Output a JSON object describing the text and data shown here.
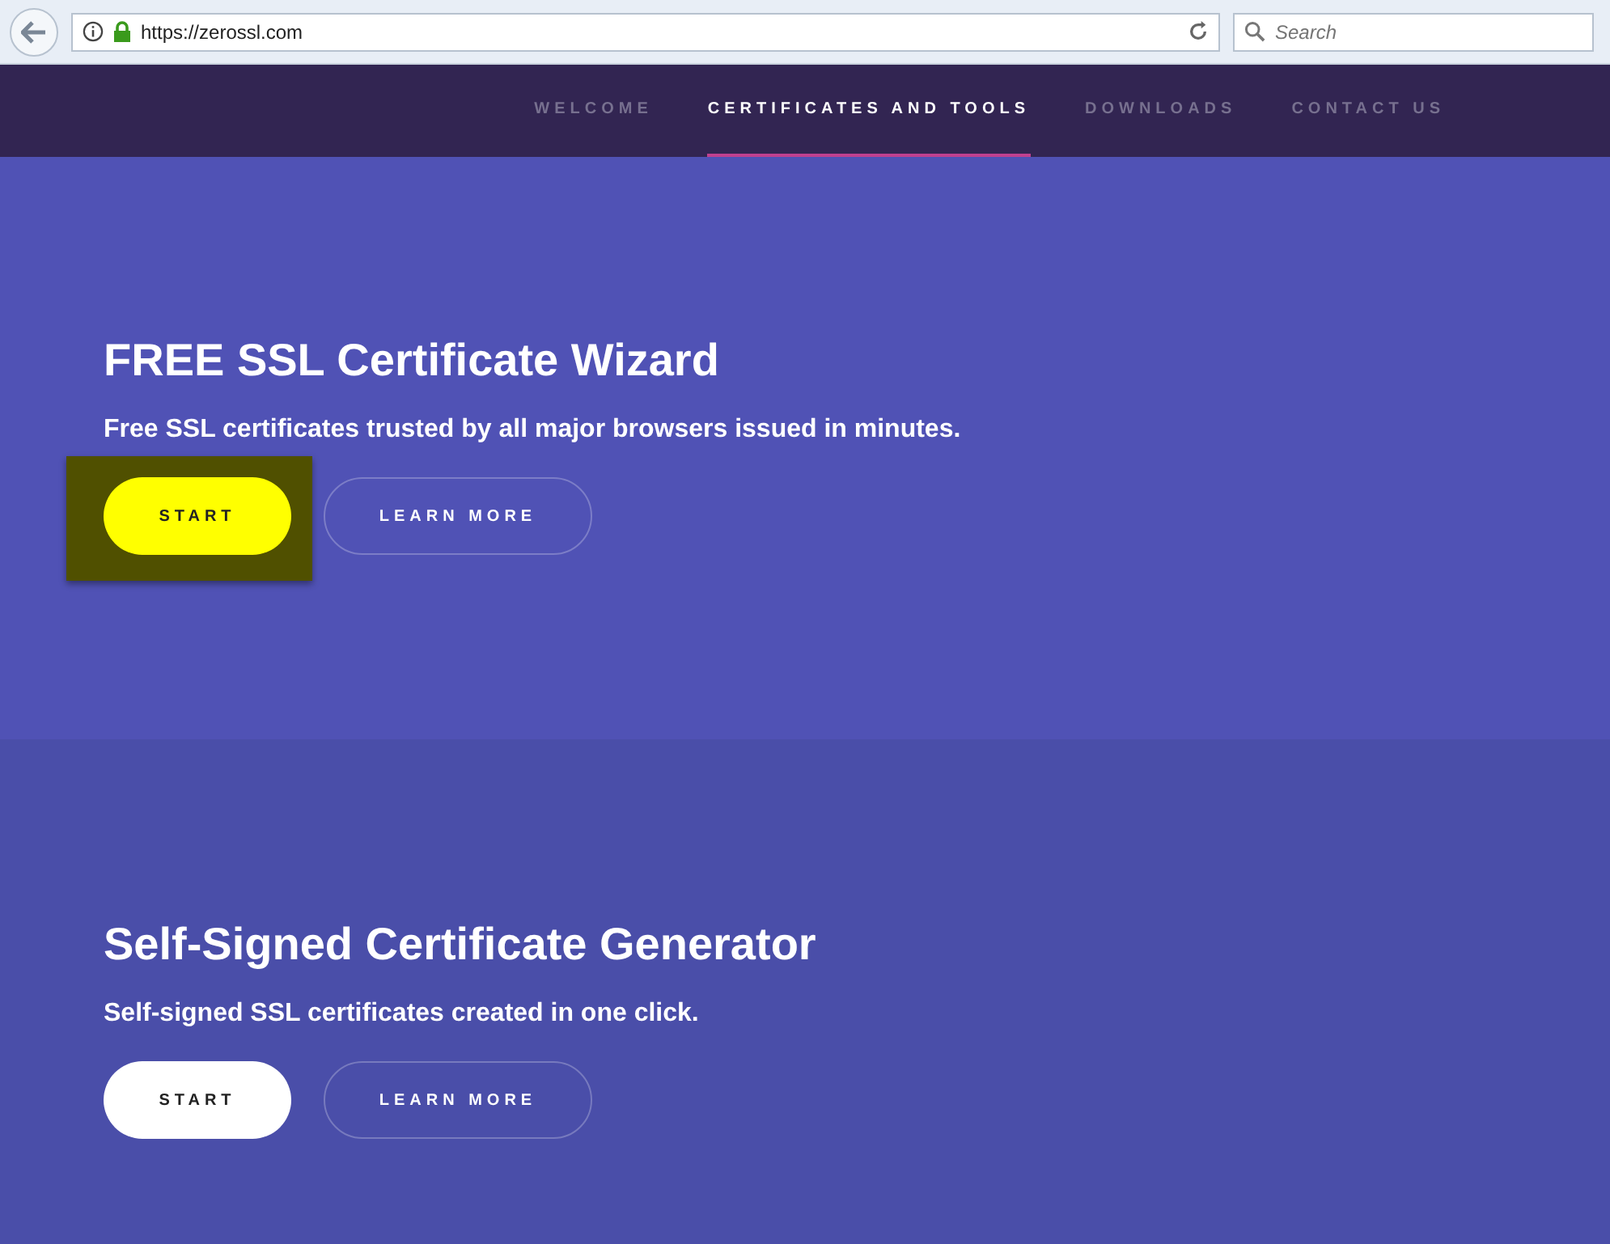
{
  "browser": {
    "url": "https://zerossl.com",
    "search": {
      "placeholder": "Search"
    }
  },
  "nav": [
    {
      "label": "WELCOME",
      "selected": false
    },
    {
      "label": "CERTIFICATES AND TOOLS",
      "selected": true
    },
    {
      "label": "DOWNLOADS",
      "selected": false
    },
    {
      "label": "CONTACT US",
      "selected": false
    }
  ],
  "sections": [
    {
      "title": "FREE SSL Certificate Wizard",
      "subtitle": "Free SSL certificates trusted by all major browsers issued in minutes.",
      "start": {
        "label": "START",
        "highlighted": true
      },
      "learn_more": "LEARN MORE"
    },
    {
      "title": "Self-Signed Certificate Generator",
      "subtitle": "Self-signed SSL certificates created in one click.",
      "start": {
        "label": "START",
        "highlighted": false
      },
      "learn_more": "LEARN MORE"
    }
  ]
}
